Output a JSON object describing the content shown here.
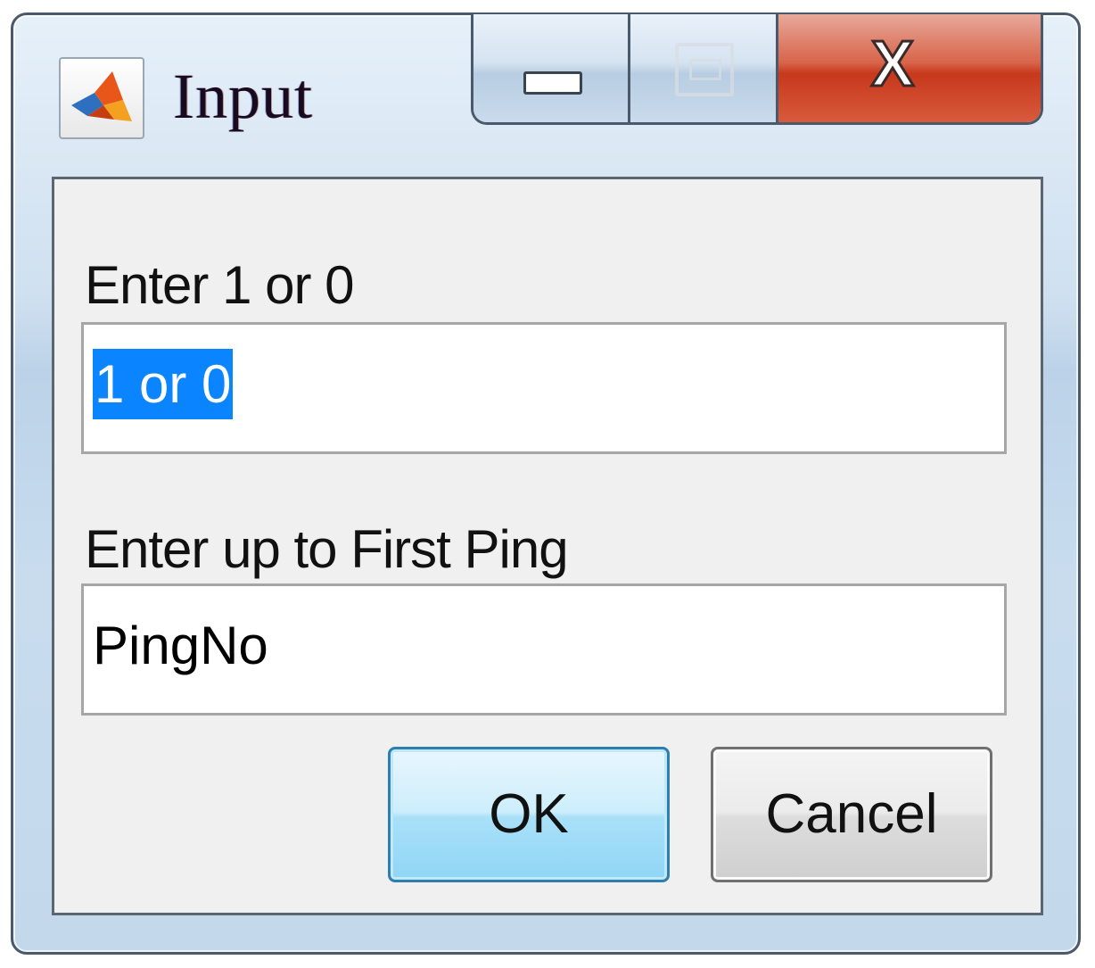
{
  "window": {
    "title": "Input",
    "app_icon": "matlab-membrane-icon",
    "caption_buttons": {
      "minimize_icon": "minimize-icon",
      "maximize_icon": "maximize-icon",
      "close_icon": "close-icon",
      "close_glyph": "X"
    }
  },
  "form": {
    "fields": [
      {
        "label": "Enter 1  or 0",
        "value": "1 or 0",
        "selected": true
      },
      {
        "label": "Enter up  to First Ping",
        "value": "PingNo",
        "selected": false
      }
    ]
  },
  "buttons": {
    "ok_label": "OK",
    "cancel_label": "Cancel"
  },
  "colors": {
    "selection": "#0a84ff",
    "close_button": "#c7381c",
    "default_button_border": "#2e7fb0"
  }
}
